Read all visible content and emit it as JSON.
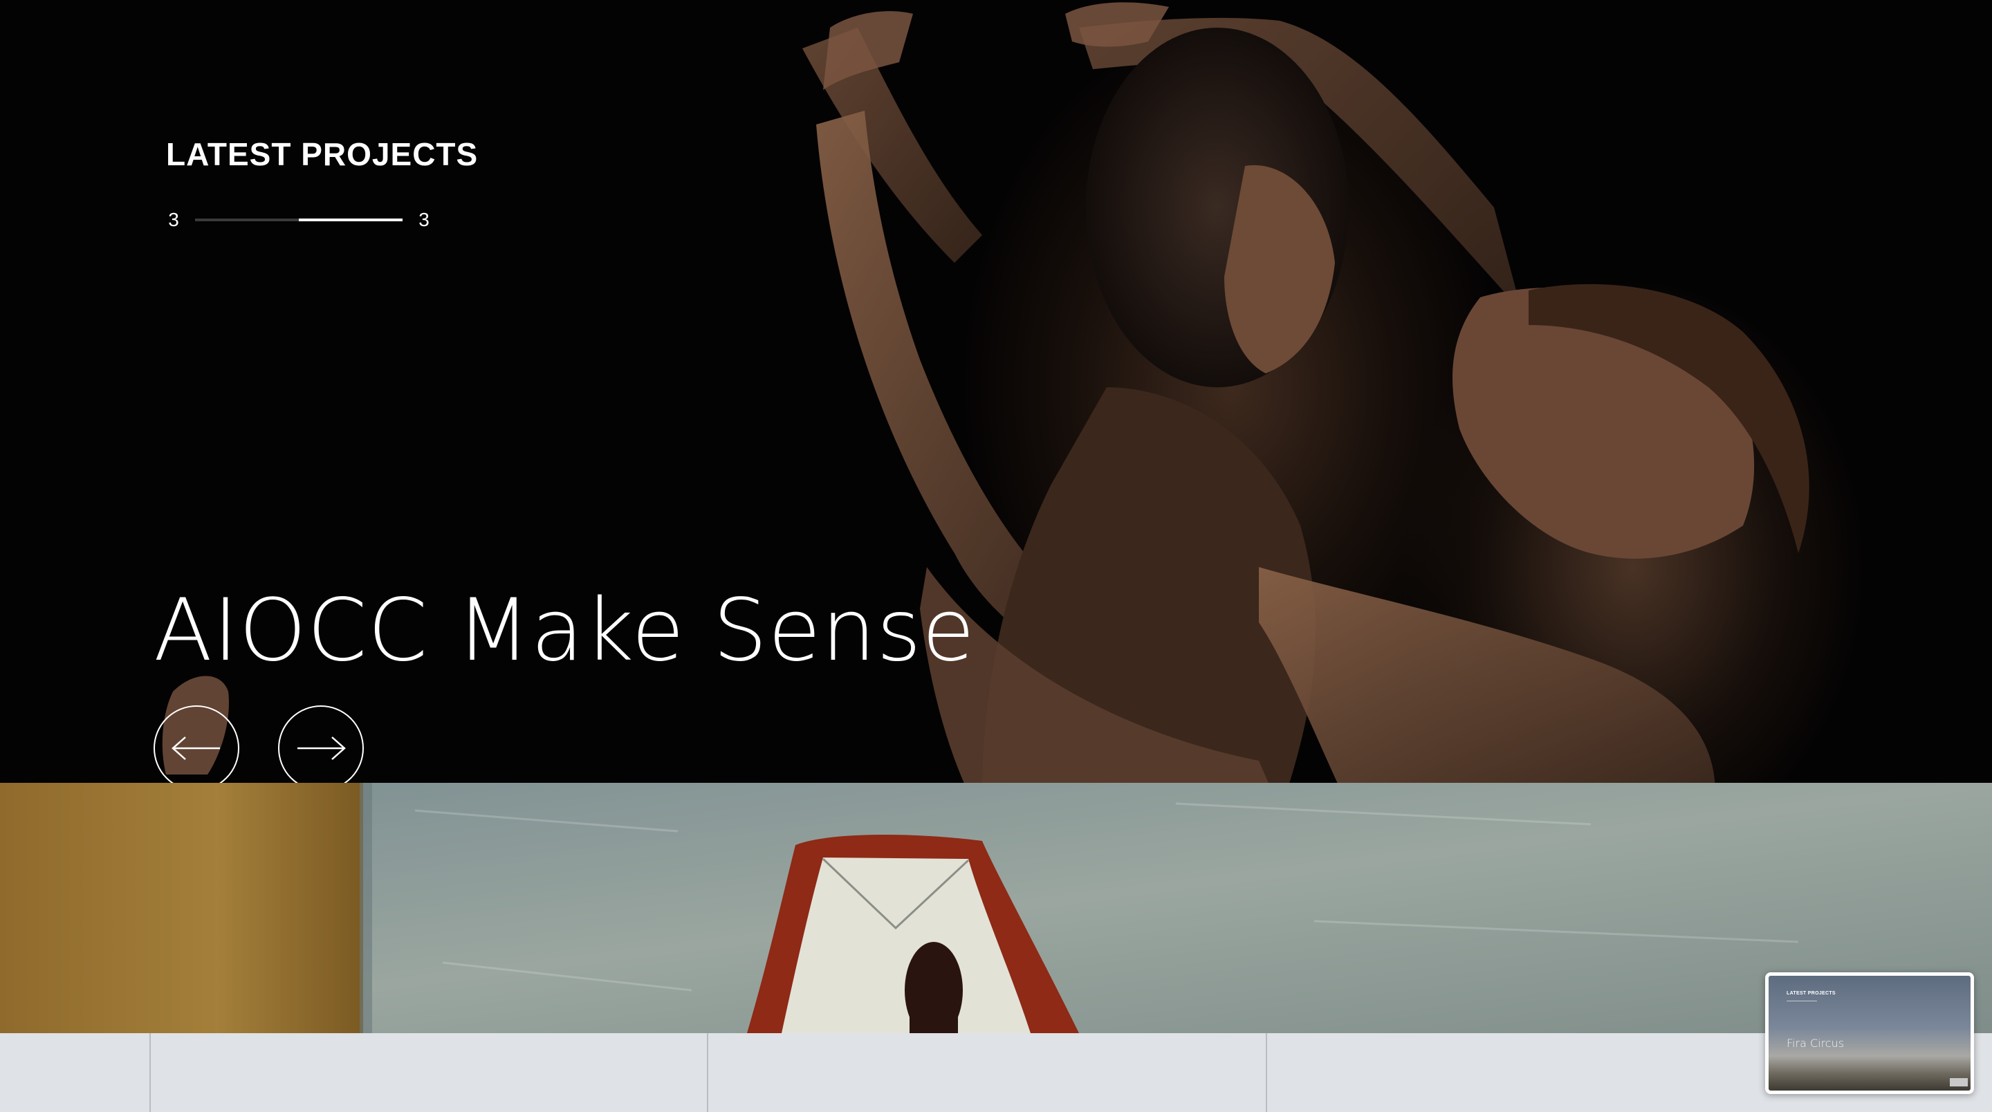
{
  "hero": {
    "section_title": "LATEST PROJECTS",
    "counter": {
      "current": "3",
      "total": "3",
      "progress_fraction": 0.5,
      "progress_start_fraction": 0.5
    },
    "project_title": "AIOCC Make Sense",
    "prev_button_icon": "arrow-left-icon",
    "next_button_icon": "arrow-right-icon"
  },
  "preview": {
    "label": "LATEST PROJECTS",
    "title": "Fira Circus"
  },
  "colors": {
    "hero_background": "#040303",
    "text": "#ffffff",
    "grid_strip": "#dfe2e6",
    "painting_ochre": "#9b7733",
    "painting_wall": "#8a9a9b",
    "painting_red": "#8e2a16"
  }
}
